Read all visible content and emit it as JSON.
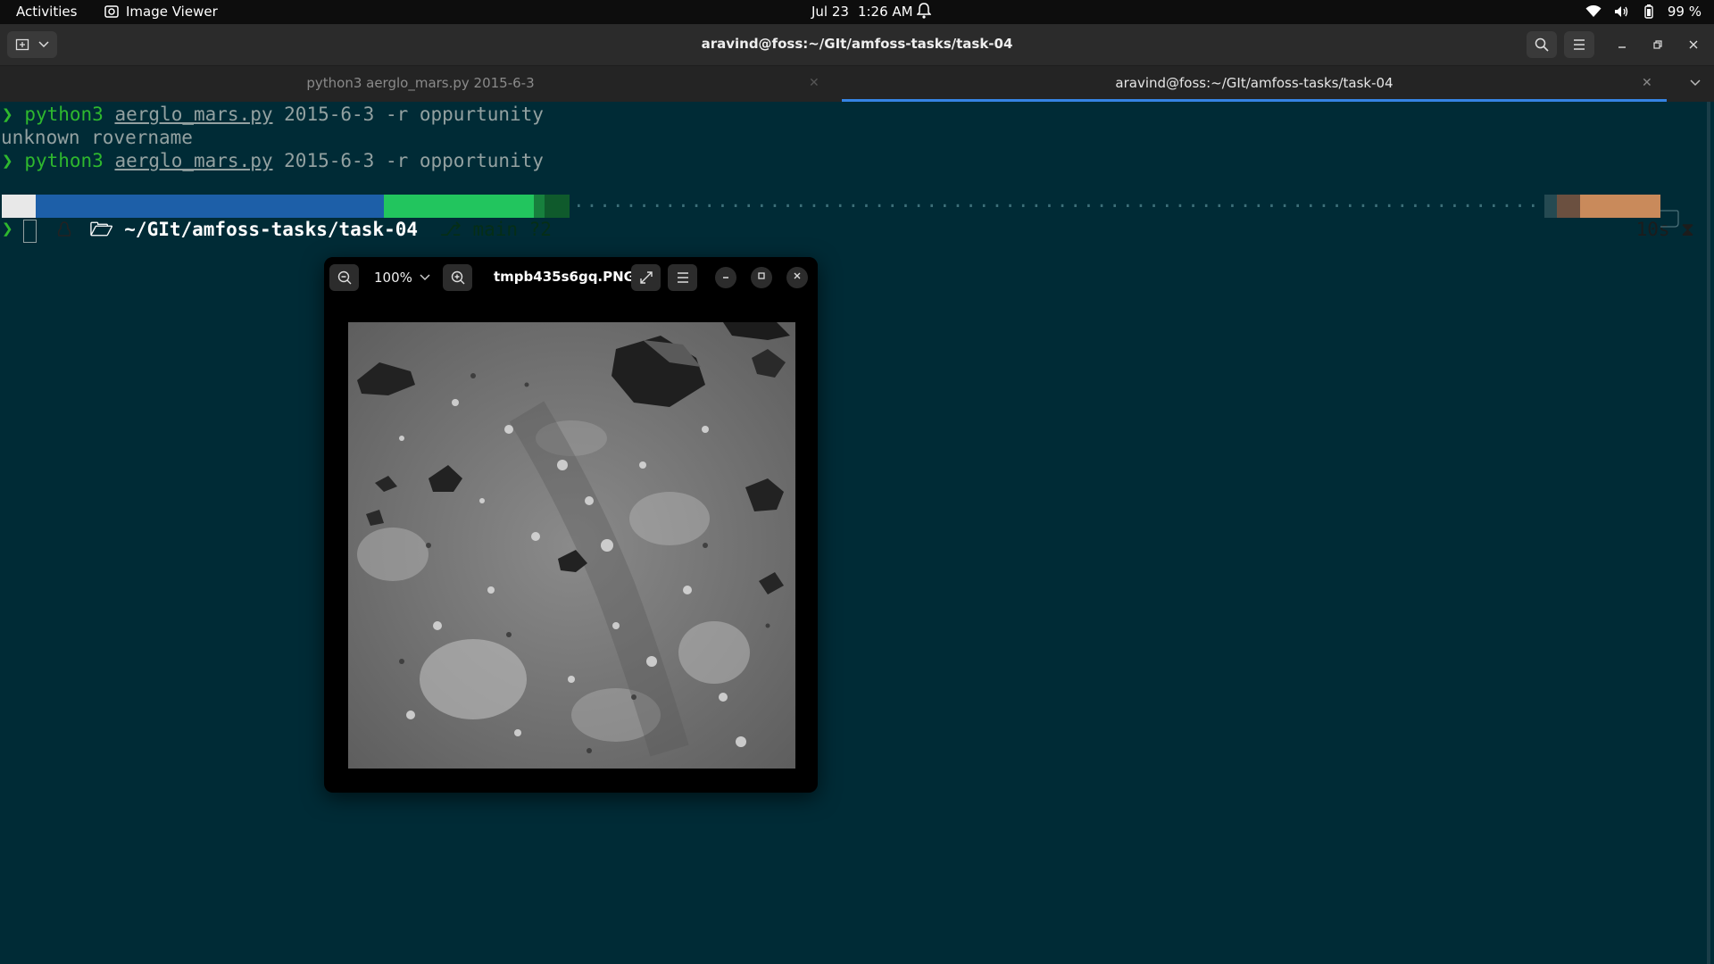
{
  "topbar": {
    "activities": "Activities",
    "app_name": "Image Viewer",
    "date": "Jul 23",
    "time": "1:26 AM",
    "battery": "99 %"
  },
  "terminal": {
    "window_title": "aravind@foss:~/GIt/amfoss-tasks/task-04",
    "tabs": [
      {
        "label": "python3 aerglo_mars.py 2015-6-3",
        "active": false
      },
      {
        "label": "aravind@foss:~/GIt/amfoss-tasks/task-04",
        "active": true
      }
    ],
    "lines": [
      {
        "prompt": "❯",
        "cmd": "python3",
        "file": "aerglo_mars.py",
        "args": "2015-6-3 -r oppurtunity"
      },
      {
        "output": "unknown rovername"
      },
      {
        "prompt": "❯",
        "cmd": "python3",
        "file": "aerglo_mars.py",
        "args": "2015-6-3 -r opportunity"
      }
    ],
    "powerline": {
      "path": "~/GIt/amfoss-tasks/task-04",
      "branch": "main ?2",
      "duration": "10s"
    },
    "cursor_prompt": "❯"
  },
  "viewer": {
    "zoom": "100%",
    "filename": "tmpb435s6gq.PNG"
  },
  "colors": {
    "terminal_bg": "#002b36",
    "prompt_green": "#2eb82e",
    "path_segment": "#1d5fa8",
    "git_segment": "#22c55e",
    "duration_segment": "#c98a5b",
    "tab_accent": "#3584e4"
  }
}
